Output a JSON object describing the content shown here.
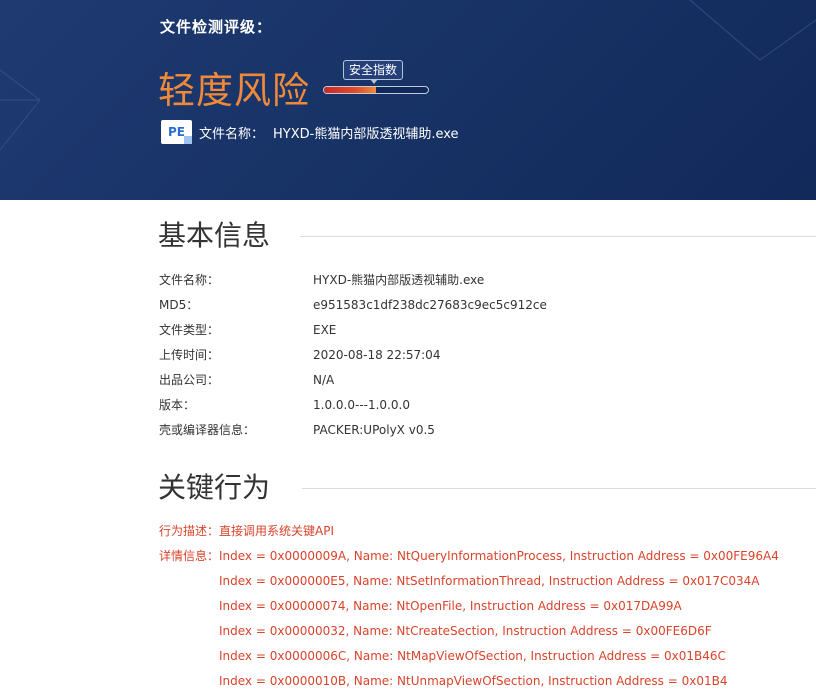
{
  "header": {
    "label": "文件检测评级：",
    "risk_level": "轻度风险",
    "safety_tooltip": "安全指数",
    "safety_index_fraction": 0.5,
    "file_icon": "PE",
    "file_name_label": "文件名称：",
    "file_name_value": "HYXD-熊猫内部版透视辅助.exe"
  },
  "basic_info": {
    "title": "基本信息",
    "rows": [
      {
        "key": "文件名称：",
        "value": "HYXD-熊猫内部版透视辅助.exe"
      },
      {
        "key": "MD5：",
        "value": "e951583c1df238dc27683c9ec5c912ce"
      },
      {
        "key": "文件类型：",
        "value": "EXE"
      },
      {
        "key": "上传时间：",
        "value": "2020-08-18 22:57:04"
      },
      {
        "key": "出品公司：",
        "value": "N/A"
      },
      {
        "key": "版本：",
        "value": "1.0.0.0---1.0.0.0"
      },
      {
        "key": "壳或编译器信息：",
        "value": "PACKER:UPolyX v0.5"
      }
    ]
  },
  "behavior": {
    "title": "关键行为",
    "desc_key": "行为描述：",
    "desc_value": "直接调用系统关键API",
    "detail_key": "详情信息：",
    "details": [
      "Index = 0x0000009A, Name: NtQueryInformationProcess, Instruction Address = 0x00FE96A4",
      "Index = 0x000000E5, Name: NtSetInformationThread, Instruction Address = 0x017C034A",
      "Index = 0x00000074, Name: NtOpenFile, Instruction Address = 0x017DA99A",
      "Index = 0x00000032, Name: NtCreateSection, Instruction Address = 0x00FE6D6F",
      "Index = 0x0000006C, Name: NtMapViewOfSection, Instruction Address = 0x01B46C",
      "Index = 0x0000010B, Name: NtUnmapViewOfSection, Instruction Address = 0x01B4"
    ]
  },
  "colors": {
    "header_bg": "#1a3468",
    "risk_orange": "#f08a3a",
    "behavior_red": "#d9432b"
  }
}
